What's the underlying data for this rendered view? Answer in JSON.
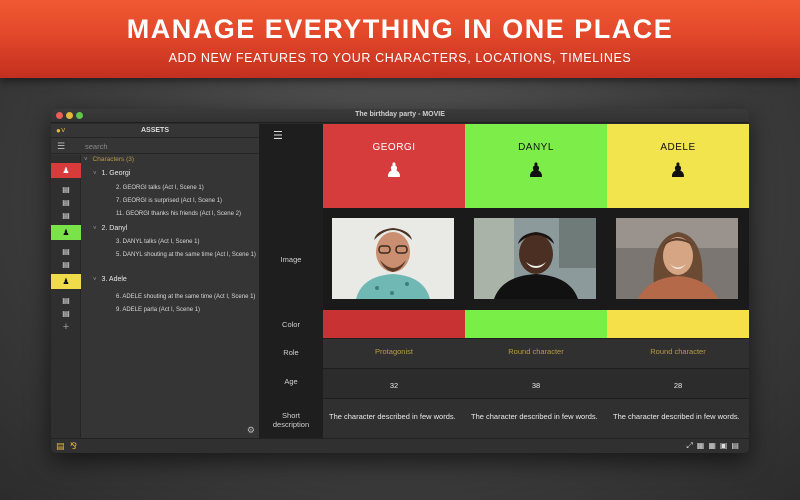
{
  "banner": {
    "title": "MANAGE EVERYTHING IN ONE PLACE",
    "subtitle": "ADD NEW FEATURES TO YOUR CHARACTERS, LOCATIONS, TIMELINES"
  },
  "window": {
    "title": "The birthday party - MOVIE"
  },
  "sidebar": {
    "title": "ASSETS",
    "search_placeholder": "search",
    "section": "Characters (3)",
    "characters": [
      {
        "label": "1. Georgi",
        "color": "#d93b3b",
        "scenes": [
          "2. GEORGI talks (Act I, Scene 1)",
          "7. GEORGI is surprised (Act I, Scene 1)",
          "11. GEORGI thanks his friends (Act I, Scene 2)"
        ]
      },
      {
        "label": "2. Danyl",
        "color": "#7be34a",
        "scenes": [
          "3. DANYL talks (Act I, Scene 1)",
          "5. DANYL shouting at the same time (Act I, Scene 1)"
        ]
      },
      {
        "label": "3. Adele",
        "color": "#f0dc4a",
        "scenes": [
          "6. ADELE shouting at the same time (Act I, Scene 1)",
          "9. ADELE parla (Act I, Scene 1)"
        ]
      }
    ]
  },
  "rows": {
    "image": "Image",
    "color": "Color",
    "role": "Role",
    "age": "Age",
    "short_description": "Short description"
  },
  "columns": [
    {
      "name": "GEORGI",
      "role": "Protagonist",
      "age": "32",
      "description": "The character described in few words.",
      "header_color": "#d63c3c",
      "swatch_color": "#c93232",
      "text_color": "#ffffff"
    },
    {
      "name": "DANYL",
      "role": "Round character",
      "age": "38",
      "description": "The character described in few words.",
      "header_color": "#7ded4a",
      "swatch_color": "#78ee46",
      "text_color": "#111111"
    },
    {
      "name": "ADELE",
      "role": "Round character",
      "age": "28",
      "description": "The character described in few words.",
      "header_color": "#f2e44c",
      "swatch_color": "#f5e04a",
      "text_color": "#111111"
    }
  ]
}
